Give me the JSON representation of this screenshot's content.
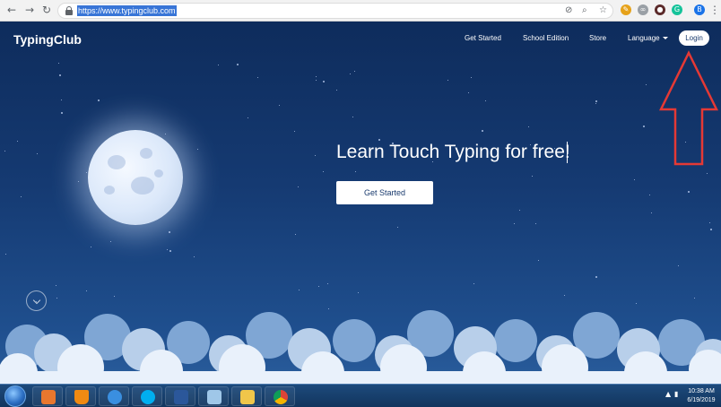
{
  "browser": {
    "back": "←",
    "forward": "→",
    "reload": "↻",
    "url": "https://www.typingclub.com",
    "profile_initial": "B"
  },
  "site": {
    "brand": "TypingClub",
    "nav": {
      "get_started": "Get Started",
      "school_edition": "School Edition",
      "store": "Store",
      "language": "Language",
      "login": "Login"
    },
    "hero": {
      "headline": "Learn Touch Typing for free!",
      "cta": "Get Started"
    }
  },
  "annotation": {
    "color": "#e53935",
    "target": "login-button"
  },
  "taskbar": {
    "apps": [
      "media-player-icon",
      "vlc-icon",
      "internet-explorer-icon",
      "skype-icon",
      "word-icon",
      "notepad-icon",
      "file-explorer-icon",
      "chrome-icon"
    ],
    "tray_arrow": "▲",
    "time": "10:38 AM",
    "date": "6/19/2019"
  },
  "colors": {
    "sky_top": "#0e2c5c",
    "sky_bottom": "#2a5d9c",
    "button_text": "#1a3b6e",
    "url_highlight": "#3875d7"
  }
}
